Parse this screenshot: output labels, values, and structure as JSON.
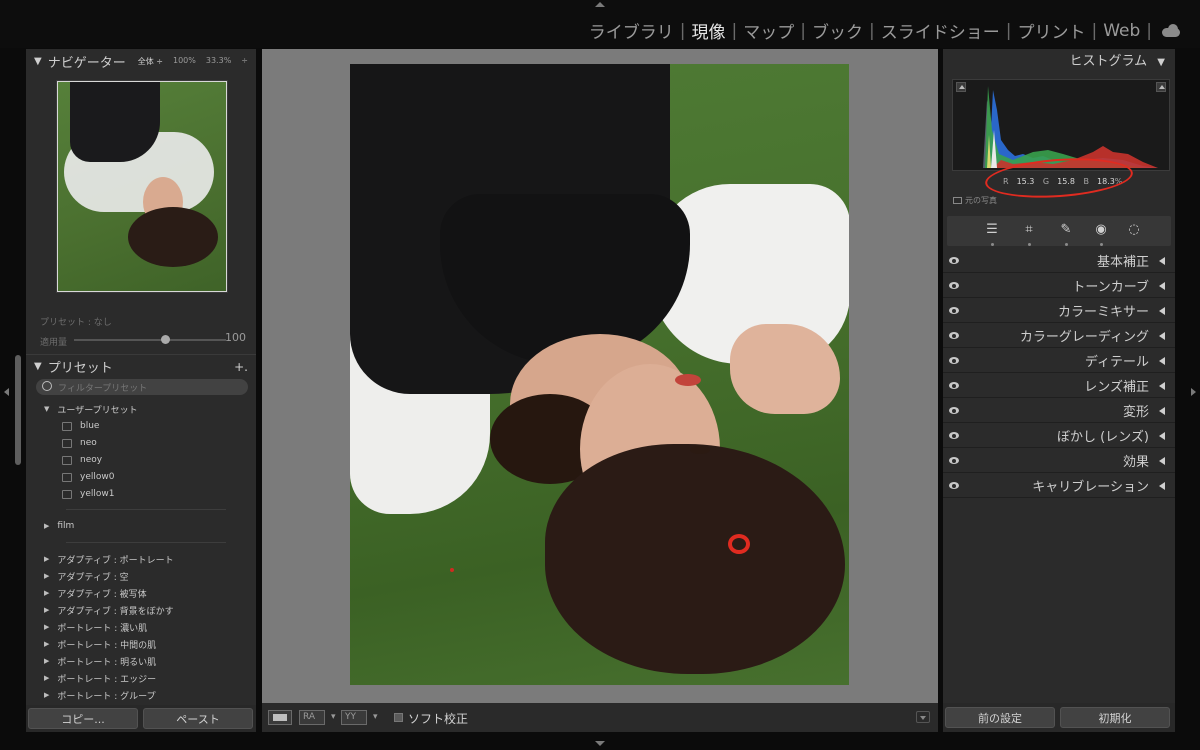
{
  "modules": {
    "items": [
      {
        "label": "ライブラリ"
      },
      {
        "label": "現像",
        "active": true
      },
      {
        "label": "マップ"
      },
      {
        "label": "ブック"
      },
      {
        "label": "スライドショー"
      },
      {
        "label": "プリント"
      },
      {
        "label": "Web"
      }
    ],
    "separator": "|"
  },
  "navigator": {
    "title": "ナビゲーター",
    "zoom": [
      "全体 ÷",
      "100%",
      "33.3%",
      "÷"
    ]
  },
  "preset_amount": {
    "preset_label": "プリセット : なし",
    "amount_label": "適用量",
    "amount_value": "100",
    "amount_fraction": 0.6
  },
  "presets": {
    "title": "プリセット",
    "add": "+.",
    "filter_placeholder": "フィルタープリセット",
    "user_group": "ユーザープリセット",
    "user_items": [
      "blue",
      "neo",
      "neoy",
      "yellow0",
      "yellow1"
    ],
    "film_group": "film",
    "builtin_groups": [
      "アダプティブ : ポートレート",
      "アダプティブ : 空",
      "アダプティブ : 被写体",
      "アダプティブ : 背景をぼかす",
      "ポートレート : 濃い肌",
      "ポートレート : 中間の肌",
      "ポートレート : 明るい肌",
      "ポートレート : エッジー",
      "ポートレート : グループ"
    ]
  },
  "left_buttons": {
    "copy": "コピー...",
    "paste": "ペースト"
  },
  "toolbar": {
    "ra": "RA",
    "yy": "YY",
    "soft_proof": "ソフト校正"
  },
  "histogram": {
    "title": "ヒストグラム",
    "r_label": "R",
    "r_value": "15.3",
    "g_label": "G",
    "g_value": "15.8",
    "b_label": "B",
    "b_value": "18.3",
    "b_unit": "%",
    "original_photo": "元の写真"
  },
  "tools": [
    "edit-sliders-icon",
    "crop-icon",
    "healing-icon",
    "red-eye-icon",
    "masking-icon"
  ],
  "sections": [
    "基本補正",
    "トーンカーブ",
    "カラーミキサー",
    "カラーグレーディング",
    "ディテール",
    "レンズ補正",
    "変形",
    "ぼかし (レンズ)",
    "効果",
    "キャリブレーション"
  ],
  "right_buttons": {
    "previous": "前の設定",
    "reset": "初期化"
  },
  "colors": {
    "accent_red": "#e02b20",
    "panel_bg": "#2b2b2b",
    "canvas_bg": "#7b7b7b"
  }
}
